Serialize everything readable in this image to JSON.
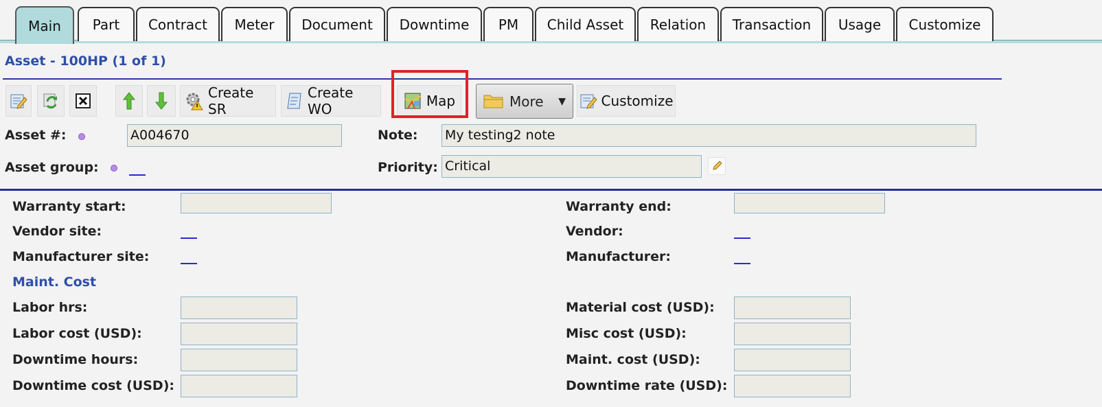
{
  "tabs": [
    "Main",
    "Part",
    "Contract",
    "Meter",
    "Document",
    "Downtime",
    "PM",
    "Child Asset",
    "Relation",
    "Transaction",
    "Usage",
    "Customize"
  ],
  "active_tab": "Main",
  "header": {
    "title": "Asset - 100HP (1 of 1)"
  },
  "toolbar": {
    "edit_icon": "edit-form-icon",
    "refresh_icon": "refresh-icon",
    "close_icon": "close-x-icon",
    "up_icon": "arrow-up-icon",
    "down_icon": "arrow-down-icon",
    "create_sr": "Create SR",
    "create_wo": "Create WO",
    "map": "Map",
    "more": "More",
    "customize": "Customize"
  },
  "form": {
    "asset_no_label": "Asset #:",
    "asset_no_value": "A004670",
    "note_label": "Note:",
    "note_value": "My testing2 note",
    "asset_group_label": "Asset group:",
    "priority_label": "Priority:",
    "priority_value": "Critical"
  },
  "details": {
    "warranty_start": "Warranty start:",
    "warranty_end": "Warranty end:",
    "vendor_site": "Vendor site:",
    "vendor": "Vendor:",
    "manufacturer_site": "Manufacturer site:",
    "manufacturer": "Manufacturer:",
    "maint_cost_title": "Maint. Cost",
    "labor_hrs": "Labor hrs:",
    "material_cost": "Material cost (USD):",
    "labor_cost": "Labor cost (USD):",
    "misc_cost": "Misc cost (USD):",
    "downtime_hours": "Downtime hours:",
    "maint_cost": "Maint. cost (USD):",
    "downtime_cost": "Downtime cost (USD):",
    "downtime_rate": "Downtime rate (USD):"
  },
  "colors": {
    "accent": "#2e4fa8",
    "active_tab": "#b0dadb",
    "highlight": "#e0222a"
  }
}
